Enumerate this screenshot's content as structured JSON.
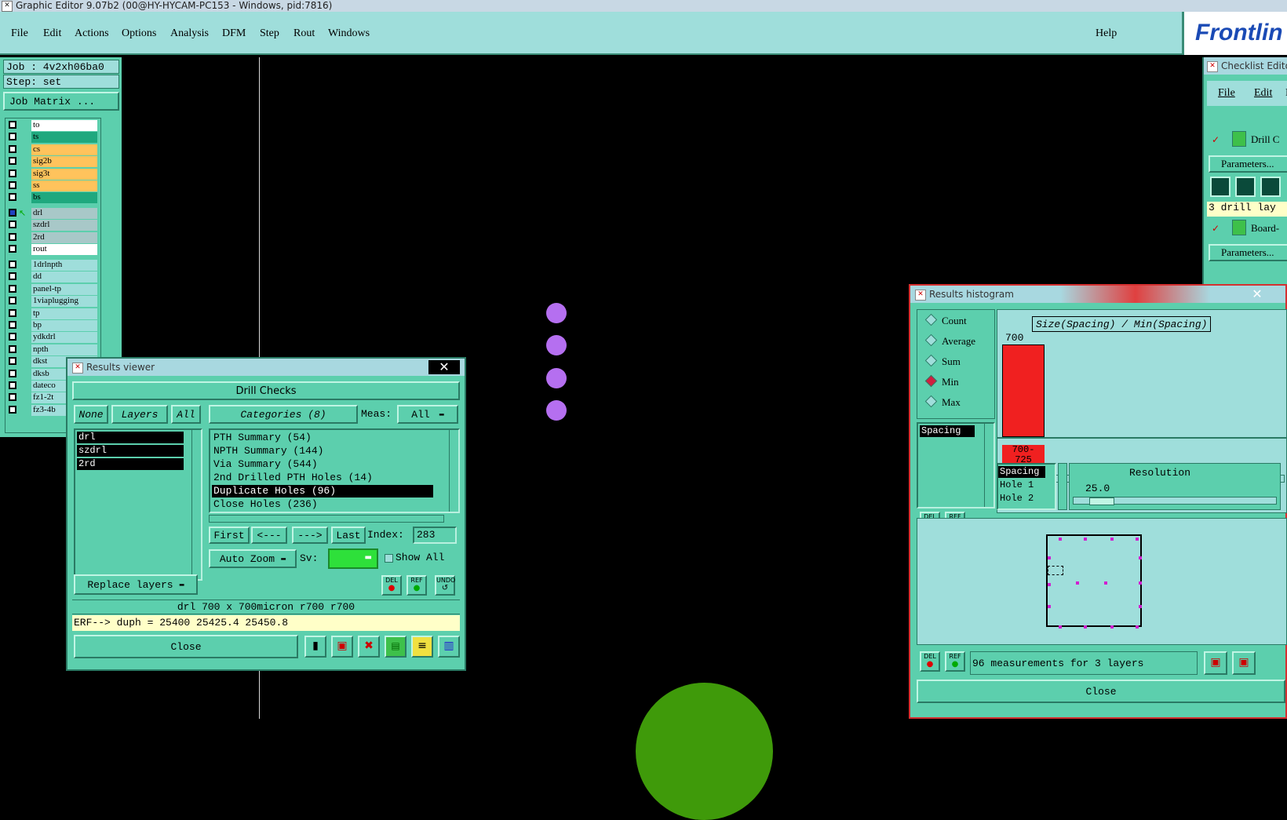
{
  "window": {
    "title": "Graphic Editor 9.07b2 (00@HY-HYCAM-PC153 - Windows, pid:7816)"
  },
  "menu": {
    "items": [
      "File",
      "Edit",
      "Actions",
      "Options",
      "Analysis",
      "DFM",
      "Step",
      "Rout",
      "Windows"
    ],
    "help": "Help"
  },
  "logo": {
    "text": "Frontlin"
  },
  "job": {
    "job_line": "Job : 4v2xh06ba0",
    "step_line": "Step: set",
    "matrix_button": "Job Matrix ..."
  },
  "layers": {
    "group1": [
      "to",
      "ts",
      "cs",
      "sig2b",
      "sig3t",
      "ss",
      "bs"
    ],
    "group2": [
      "drl",
      "szdrl",
      "2rd",
      "rout"
    ],
    "group3": [
      "1drlnpth",
      "dd",
      "panel-tp",
      "1viaplugging",
      "tp",
      "bp",
      "ydkdrl",
      "npth",
      "dkst",
      "dksb",
      "dateco",
      "fz1-2t",
      "fz3-4b"
    ]
  },
  "results_viewer": {
    "title": "Results viewer",
    "header": "Drill Checks",
    "none_btn": "None",
    "layers_btn": "Layers",
    "all_btn": "All",
    "categories_btn": "Categories (8)",
    "meas_label": "Meas:",
    "meas_value": "All",
    "layer_list": [
      "drl",
      "szdrl",
      "2rd"
    ],
    "categories": [
      "PTH Summary (54)",
      "NPTH Summary (144)",
      "Via Summary (544)",
      "2nd Drilled PTH Holes (14)",
      "Duplicate Holes (96)",
      "Close Holes (236)"
    ],
    "nav": {
      "first": "First",
      "prev": "<---",
      "next": "--->",
      "last": "Last",
      "index_label": "Index:",
      "index_value": "283"
    },
    "auto_zoom": "Auto Zoom",
    "sv_label": "Sv:",
    "show_all": "Show All",
    "replace_layers": "Replace layers",
    "info_line": "drl 700 x 700micron  r700  r700",
    "erf_line": "ERF--> duph = 25400 25425.4 25450.8",
    "close": "Close",
    "del": "DEL",
    "ref": "REF",
    "undo": "UNDO"
  },
  "checklist": {
    "title": "Checklist Edito",
    "menu": [
      "File",
      "Edit",
      "F"
    ],
    "drill_label": "Drill C",
    "parameters": "Parameters...",
    "drill_layers": "3 drill lay",
    "board_label": "Board-",
    "parameters2": "Parameters..."
  },
  "histogram": {
    "title": "Results histogram",
    "modes": [
      "Count",
      "Average",
      "Sum",
      "Min",
      "Max"
    ],
    "selected_mode": "Min",
    "measure_list": [
      "Spacing"
    ],
    "chart_title": "Size(Spacing) / Min(Spacing)",
    "bar_value": "700",
    "bin_label": "700-\n725",
    "spacing_list": [
      "Spacing",
      "Hole 1",
      "Hole 2"
    ],
    "resolution_label": "Resolution",
    "resolution_value": "25.0",
    "measurements": "96 measurements for 3 layers",
    "del": "DEL",
    "ref": "REF",
    "close": "Close"
  },
  "colors": {
    "panel": "#5ccfad",
    "light": "#9fdedb",
    "dot": "#b56ff0",
    "pad": "#3f9a0a",
    "bar": "#f02020"
  }
}
